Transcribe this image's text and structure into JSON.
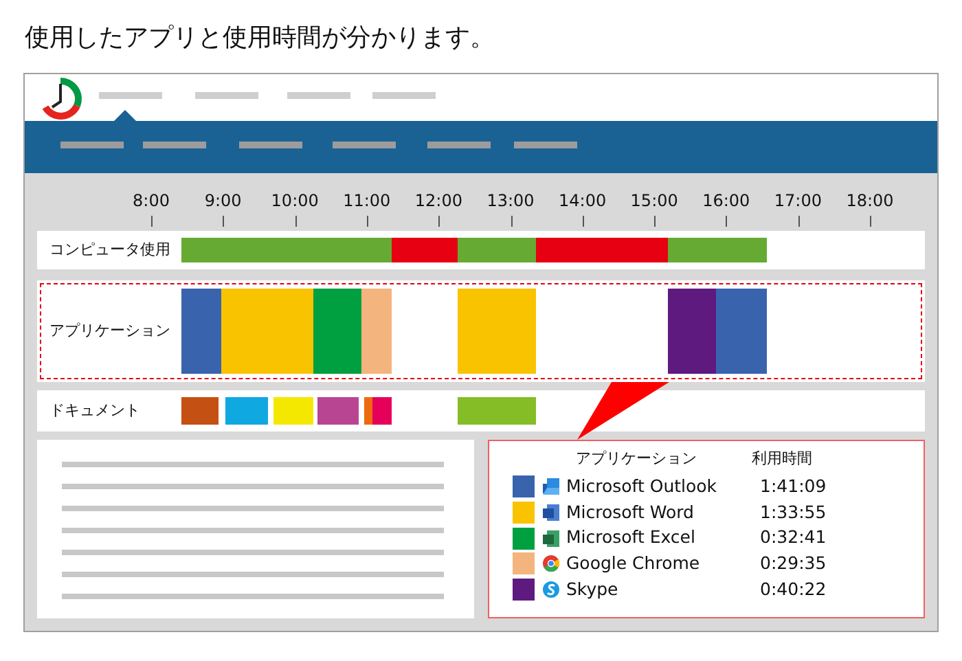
{
  "headline": "使用したアプリと使用時間が分かります。",
  "timeline": {
    "hours": [
      "8:00",
      "9:00",
      "10:00",
      "11:00",
      "12:00",
      "13:00",
      "14:00",
      "15:00",
      "16:00",
      "17:00",
      "18:00"
    ],
    "rows": [
      {
        "label": "コンピュータ使用",
        "highlighted": false,
        "segments": [
          {
            "color": "#66aa33"
          },
          {
            "color": "#e60012"
          },
          {
            "color": "#66aa33"
          },
          {
            "color": "#e60012"
          },
          {
            "color": "#66aa33"
          }
        ]
      },
      {
        "label": "アプリケーション",
        "highlighted": true,
        "segments": [
          {
            "color": "#3a63ad"
          },
          {
            "color": "#f9c300"
          },
          {
            "color": "#00a040"
          },
          {
            "color": "#f4b47e"
          },
          {
            "color": "#f9c300"
          },
          {
            "color": "#5f1a80"
          },
          {
            "color": "#3a63ad"
          }
        ]
      },
      {
        "label": "ドキュメント",
        "highlighted": false,
        "segments": [
          {
            "color": "#c55014"
          },
          {
            "color": "#10a8e0"
          },
          {
            "color": "#f5e800"
          },
          {
            "color": "#b84592"
          },
          {
            "color": "#ee6a10"
          },
          {
            "color": "#e5005a"
          },
          {
            "color": "#84bd26"
          }
        ]
      }
    ]
  },
  "usage_table": {
    "columns": [
      "アプリケーション",
      "利用時間"
    ],
    "rows": [
      {
        "name": "Microsoft Outlook",
        "time": "1:41:09",
        "color": "#3a63ad"
      },
      {
        "name": "Microsoft Word",
        "time": "1:33:55",
        "color": "#f9c300"
      },
      {
        "name": "Microsoft Excel",
        "time": "0:32:41",
        "color": "#00a040"
      },
      {
        "name": "Google Chrome",
        "time": "0:29:35",
        "color": "#f4b47e"
      },
      {
        "name": "Skype",
        "time": "0:40:22",
        "color": "#5f1a80"
      }
    ]
  }
}
